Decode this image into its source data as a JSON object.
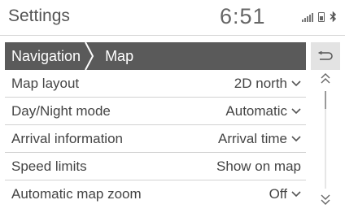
{
  "status_bar": {
    "title": "Settings",
    "clock": "6:51",
    "icons": [
      "signal-icon",
      "battery-icon",
      "bluetooth-icon"
    ],
    "bluetooth_glyph": "ʙ"
  },
  "breadcrumb": {
    "items": [
      {
        "label": "Navigation"
      },
      {
        "label": "Map"
      }
    ],
    "bar_color": "#5a5a5a"
  },
  "back_button": {
    "icon": "back-icon"
  },
  "settings": [
    {
      "label": "Map layout",
      "value": "2D north",
      "dropdown": true
    },
    {
      "label": "Day/Night mode",
      "value": "Automatic",
      "dropdown": true
    },
    {
      "label": "Arrival information",
      "value": "Arrival time",
      "dropdown": true
    },
    {
      "label": "Speed limits",
      "value": "Show on map",
      "dropdown": false
    },
    {
      "label": "Automatic map zoom",
      "value": "Off",
      "dropdown": true
    }
  ],
  "scroll": {
    "up_icon": "scroll-up-icon",
    "down_icon": "scroll-down-icon",
    "position": 0.0
  }
}
